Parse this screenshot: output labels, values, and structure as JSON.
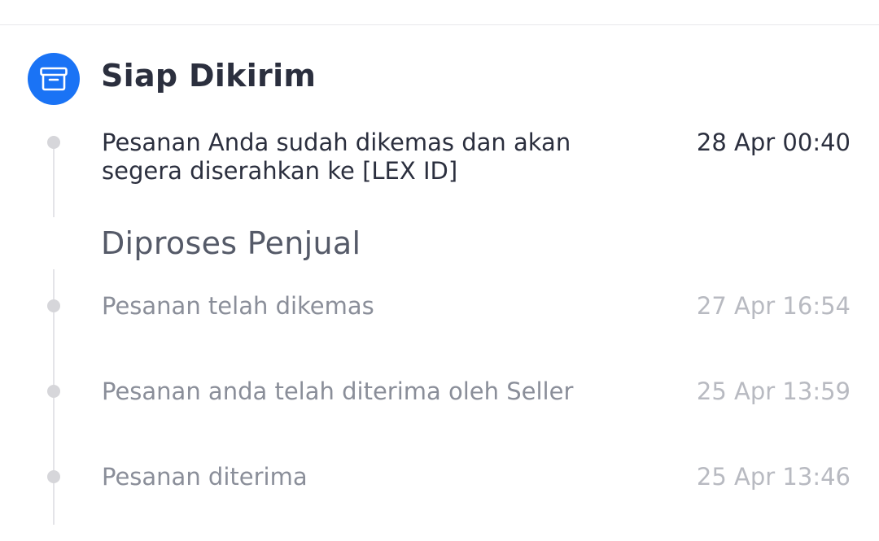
{
  "active_status": {
    "title": "Siap Dikirim",
    "icon": "archive-box-icon",
    "icon_bg_color": "#1a73f5",
    "event": {
      "text": "Pesanan Anda sudah dikemas dan akan segera diserahkan ke [LEX ID]",
      "time": "28 Apr 00:40"
    }
  },
  "group": {
    "title": "Diproses Penjual",
    "events": [
      {
        "text": "Pesanan telah dikemas",
        "time": "27 Apr 16:54"
      },
      {
        "text": "Pesanan anda telah diterima oleh Seller",
        "time": "25 Apr 13:59"
      },
      {
        "text": "Pesanan diterima",
        "time": "25 Apr 13:46"
      }
    ]
  }
}
